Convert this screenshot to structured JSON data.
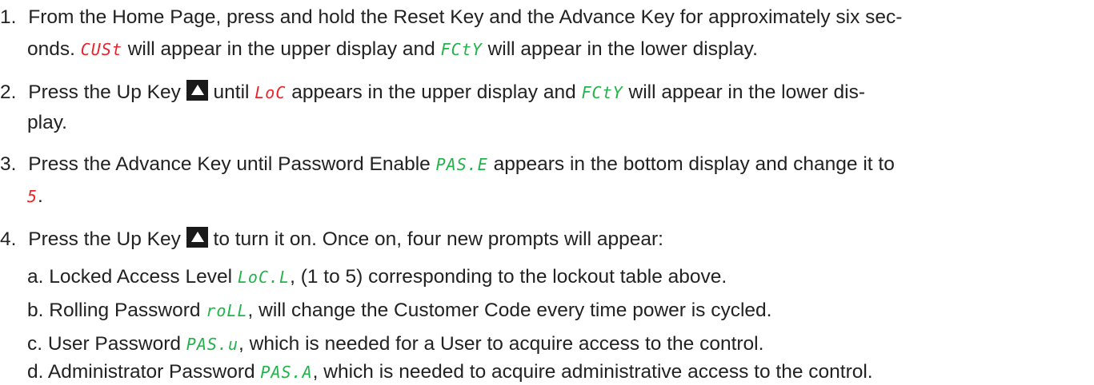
{
  "steps": [
    {
      "num": "1.",
      "a": "From the Home Page, press and hold the Reset Key and the Advance Key for approximately six sec-",
      "b": "onds. ",
      "code1": "CUSt",
      "c": " will appear in the upper display and ",
      "code2": "FCtY",
      "d": " will appear in the lower display."
    },
    {
      "num": "2.",
      "a": "Press the Up Key ",
      "b": " until ",
      "code1": "LoC",
      "c": " appears in the upper display and ",
      "code2": "FCtY",
      "d": " will appear in the lower dis-",
      "e": "play."
    },
    {
      "num": "3.",
      "a": "Press the Advance Key until Password Enable ",
      "code1": "PAS.E",
      "b": " appears in the bottom display and change it to",
      "code2": "5",
      "c": "."
    },
    {
      "num": "4.",
      "a": "Press the Up Key ",
      "b": " to turn it on. Once on, four new prompts will appear:"
    }
  ],
  "substeps": [
    {
      "letter": "a.",
      "label": "Locked Access Level ",
      "code": "LoC.L",
      "text": ", (1 to 5) corresponding to the lockout table above."
    },
    {
      "letter": "b.",
      "label": "Rolling Password ",
      "code": "roLL",
      "text": ", will change the Customer Code every time power is cycled."
    },
    {
      "letter": "c.",
      "label": "User Password ",
      "code": "PAS.u",
      "text": ", which is needed for a User to acquire access to the control."
    },
    {
      "letter": "d.",
      "label": "Administrator Password ",
      "code": "PAS.A",
      "text": ", which is needed to acquire administrative access to the control."
    }
  ],
  "icons": {
    "up_key": "up-key-icon"
  },
  "colors": {
    "upper_display": "#e8242b",
    "lower_display": "#22b34a"
  }
}
